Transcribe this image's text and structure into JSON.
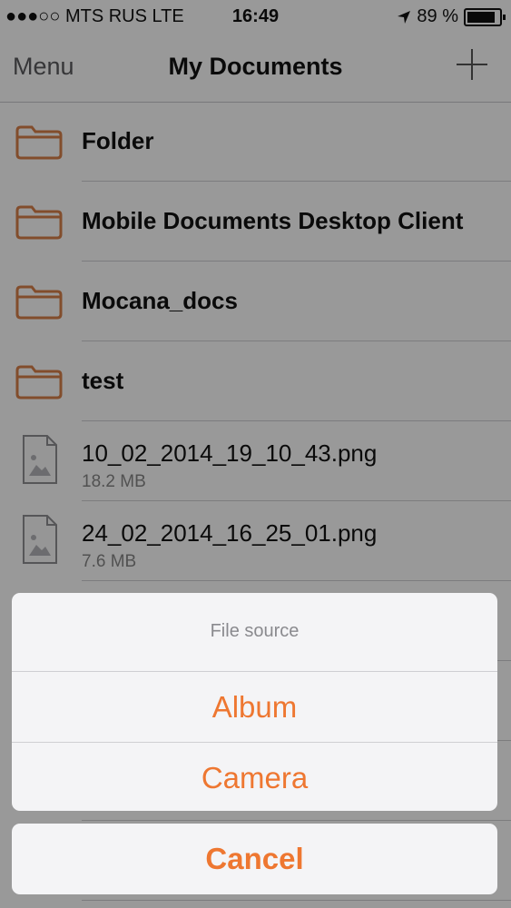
{
  "status_bar": {
    "carrier": "●●●○○ MTS RUS  LTE",
    "time": "16:49",
    "battery": "89 %"
  },
  "nav": {
    "menu_label": "Menu",
    "title": "My Documents",
    "add_icon": "plus-icon"
  },
  "items": [
    {
      "name": "Folder",
      "icon": "folder-icon"
    },
    {
      "name": "Mobile Documents Desktop Client",
      "icon": "folder-icon"
    },
    {
      "name": "Mocana_docs",
      "icon": "folder-icon"
    },
    {
      "name": "test",
      "icon": "folder-icon"
    },
    {
      "name": "10_02_2014_19_10_43.png",
      "size": "18.2 MB",
      "icon": "image-file-icon"
    },
    {
      "name": "24_02_2014_16_25_01.png",
      "size": "7.6 MB",
      "icon": "image-file-icon"
    }
  ],
  "action_sheet": {
    "title": "File source",
    "album_label": "Album",
    "camera_label": "Camera",
    "cancel_label": "Cancel"
  },
  "colors": {
    "accent": "#ee7731",
    "folder": "#d9804a"
  }
}
